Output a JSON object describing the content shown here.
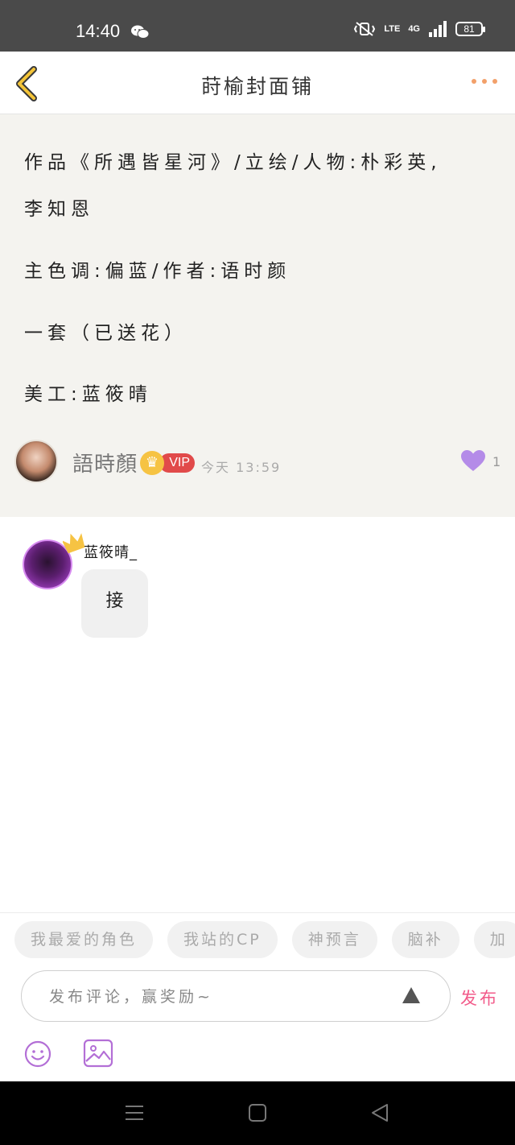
{
  "status_bar": {
    "time": "14:40",
    "network": "4G",
    "lte": "LTE",
    "battery": "81"
  },
  "nav": {
    "title": "莳榆封面铺"
  },
  "post": {
    "lines": [
      "作品《所遇皆星河》/立绘/人物:朴彩英,",
      "李知恩",
      "主色调:偏蓝/作者:语时颜",
      "一套（已送花）",
      "美工:蓝筱晴"
    ],
    "author": {
      "name": "語時顏",
      "badge": "VIP",
      "time": "今天 13:59"
    },
    "likes": "1"
  },
  "comment": {
    "name": "蓝筱晴_",
    "text": "接"
  },
  "footer": {
    "chips": [
      "我最爱的角色",
      "我站的CP",
      "神预言",
      "脑补",
      "加"
    ],
    "input_placeholder": "发布评论，赢奖励~",
    "publish_label": "发布"
  },
  "colors": {
    "accent": "#f25b8a",
    "like": "#b48be8",
    "vip": "#e14a4a",
    "back": "#f4c437"
  }
}
